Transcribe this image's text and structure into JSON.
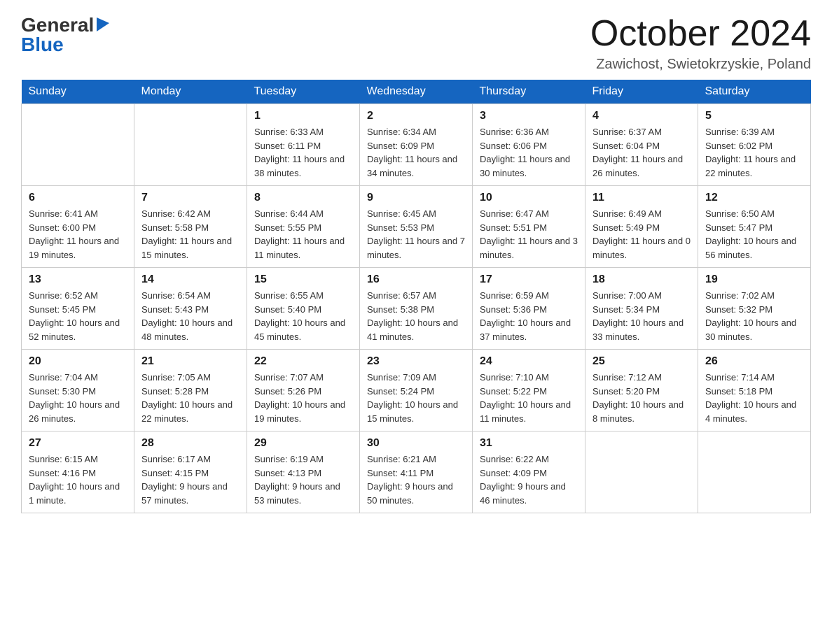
{
  "header": {
    "logo_line1": "General",
    "logo_line2": "Blue",
    "month_title": "October 2024",
    "location": "Zawichost, Swietokrzyskie, Poland"
  },
  "days_of_week": [
    "Sunday",
    "Monday",
    "Tuesday",
    "Wednesday",
    "Thursday",
    "Friday",
    "Saturday"
  ],
  "weeks": [
    [
      {
        "day": "",
        "sunrise": "",
        "sunset": "",
        "daylight": ""
      },
      {
        "day": "",
        "sunrise": "",
        "sunset": "",
        "daylight": ""
      },
      {
        "day": "1",
        "sunrise": "Sunrise: 6:33 AM",
        "sunset": "Sunset: 6:11 PM",
        "daylight": "Daylight: 11 hours and 38 minutes."
      },
      {
        "day": "2",
        "sunrise": "Sunrise: 6:34 AM",
        "sunset": "Sunset: 6:09 PM",
        "daylight": "Daylight: 11 hours and 34 minutes."
      },
      {
        "day": "3",
        "sunrise": "Sunrise: 6:36 AM",
        "sunset": "Sunset: 6:06 PM",
        "daylight": "Daylight: 11 hours and 30 minutes."
      },
      {
        "day": "4",
        "sunrise": "Sunrise: 6:37 AM",
        "sunset": "Sunset: 6:04 PM",
        "daylight": "Daylight: 11 hours and 26 minutes."
      },
      {
        "day": "5",
        "sunrise": "Sunrise: 6:39 AM",
        "sunset": "Sunset: 6:02 PM",
        "daylight": "Daylight: 11 hours and 22 minutes."
      }
    ],
    [
      {
        "day": "6",
        "sunrise": "Sunrise: 6:41 AM",
        "sunset": "Sunset: 6:00 PM",
        "daylight": "Daylight: 11 hours and 19 minutes."
      },
      {
        "day": "7",
        "sunrise": "Sunrise: 6:42 AM",
        "sunset": "Sunset: 5:58 PM",
        "daylight": "Daylight: 11 hours and 15 minutes."
      },
      {
        "day": "8",
        "sunrise": "Sunrise: 6:44 AM",
        "sunset": "Sunset: 5:55 PM",
        "daylight": "Daylight: 11 hours and 11 minutes."
      },
      {
        "day": "9",
        "sunrise": "Sunrise: 6:45 AM",
        "sunset": "Sunset: 5:53 PM",
        "daylight": "Daylight: 11 hours and 7 minutes."
      },
      {
        "day": "10",
        "sunrise": "Sunrise: 6:47 AM",
        "sunset": "Sunset: 5:51 PM",
        "daylight": "Daylight: 11 hours and 3 minutes."
      },
      {
        "day": "11",
        "sunrise": "Sunrise: 6:49 AM",
        "sunset": "Sunset: 5:49 PM",
        "daylight": "Daylight: 11 hours and 0 minutes."
      },
      {
        "day": "12",
        "sunrise": "Sunrise: 6:50 AM",
        "sunset": "Sunset: 5:47 PM",
        "daylight": "Daylight: 10 hours and 56 minutes."
      }
    ],
    [
      {
        "day": "13",
        "sunrise": "Sunrise: 6:52 AM",
        "sunset": "Sunset: 5:45 PM",
        "daylight": "Daylight: 10 hours and 52 minutes."
      },
      {
        "day": "14",
        "sunrise": "Sunrise: 6:54 AM",
        "sunset": "Sunset: 5:43 PM",
        "daylight": "Daylight: 10 hours and 48 minutes."
      },
      {
        "day": "15",
        "sunrise": "Sunrise: 6:55 AM",
        "sunset": "Sunset: 5:40 PM",
        "daylight": "Daylight: 10 hours and 45 minutes."
      },
      {
        "day": "16",
        "sunrise": "Sunrise: 6:57 AM",
        "sunset": "Sunset: 5:38 PM",
        "daylight": "Daylight: 10 hours and 41 minutes."
      },
      {
        "day": "17",
        "sunrise": "Sunrise: 6:59 AM",
        "sunset": "Sunset: 5:36 PM",
        "daylight": "Daylight: 10 hours and 37 minutes."
      },
      {
        "day": "18",
        "sunrise": "Sunrise: 7:00 AM",
        "sunset": "Sunset: 5:34 PM",
        "daylight": "Daylight: 10 hours and 33 minutes."
      },
      {
        "day": "19",
        "sunrise": "Sunrise: 7:02 AM",
        "sunset": "Sunset: 5:32 PM",
        "daylight": "Daylight: 10 hours and 30 minutes."
      }
    ],
    [
      {
        "day": "20",
        "sunrise": "Sunrise: 7:04 AM",
        "sunset": "Sunset: 5:30 PM",
        "daylight": "Daylight: 10 hours and 26 minutes."
      },
      {
        "day": "21",
        "sunrise": "Sunrise: 7:05 AM",
        "sunset": "Sunset: 5:28 PM",
        "daylight": "Daylight: 10 hours and 22 minutes."
      },
      {
        "day": "22",
        "sunrise": "Sunrise: 7:07 AM",
        "sunset": "Sunset: 5:26 PM",
        "daylight": "Daylight: 10 hours and 19 minutes."
      },
      {
        "day": "23",
        "sunrise": "Sunrise: 7:09 AM",
        "sunset": "Sunset: 5:24 PM",
        "daylight": "Daylight: 10 hours and 15 minutes."
      },
      {
        "day": "24",
        "sunrise": "Sunrise: 7:10 AM",
        "sunset": "Sunset: 5:22 PM",
        "daylight": "Daylight: 10 hours and 11 minutes."
      },
      {
        "day": "25",
        "sunrise": "Sunrise: 7:12 AM",
        "sunset": "Sunset: 5:20 PM",
        "daylight": "Daylight: 10 hours and 8 minutes."
      },
      {
        "day": "26",
        "sunrise": "Sunrise: 7:14 AM",
        "sunset": "Sunset: 5:18 PM",
        "daylight": "Daylight: 10 hours and 4 minutes."
      }
    ],
    [
      {
        "day": "27",
        "sunrise": "Sunrise: 6:15 AM",
        "sunset": "Sunset: 4:16 PM",
        "daylight": "Daylight: 10 hours and 1 minute."
      },
      {
        "day": "28",
        "sunrise": "Sunrise: 6:17 AM",
        "sunset": "Sunset: 4:15 PM",
        "daylight": "Daylight: 9 hours and 57 minutes."
      },
      {
        "day": "29",
        "sunrise": "Sunrise: 6:19 AM",
        "sunset": "Sunset: 4:13 PM",
        "daylight": "Daylight: 9 hours and 53 minutes."
      },
      {
        "day": "30",
        "sunrise": "Sunrise: 6:21 AM",
        "sunset": "Sunset: 4:11 PM",
        "daylight": "Daylight: 9 hours and 50 minutes."
      },
      {
        "day": "31",
        "sunrise": "Sunrise: 6:22 AM",
        "sunset": "Sunset: 4:09 PM",
        "daylight": "Daylight: 9 hours and 46 minutes."
      },
      {
        "day": "",
        "sunrise": "",
        "sunset": "",
        "daylight": ""
      },
      {
        "day": "",
        "sunrise": "",
        "sunset": "",
        "daylight": ""
      }
    ]
  ]
}
